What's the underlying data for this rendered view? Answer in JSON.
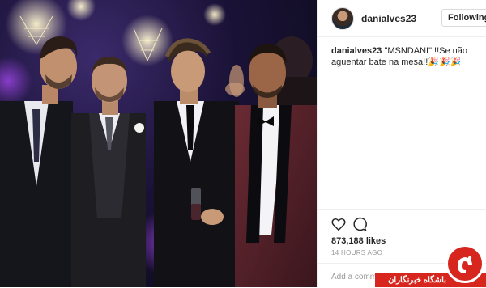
{
  "post": {
    "photo_description_icon": "party-photo",
    "header": {
      "username": "danialves23",
      "follow_label": "Following"
    },
    "caption": {
      "username": "danialves23",
      "text": "\"MSNDANI\" !!Se não aguentar bate na mesa!!🎉🎉🎉"
    },
    "actions": {
      "like_icon": "heart-icon",
      "comment_icon": "comment-icon",
      "likes_text": "873,188 likes",
      "time_text": "14 HOURS AGO"
    },
    "comment_input": {
      "placeholder": "Add a comment…"
    }
  },
  "watermark": {
    "text": "باشگاه خبرنگاران"
  },
  "colors": {
    "text": "#262626",
    "muted": "#999999",
    "border": "#efefef",
    "watermark_red": "#d7261e"
  }
}
